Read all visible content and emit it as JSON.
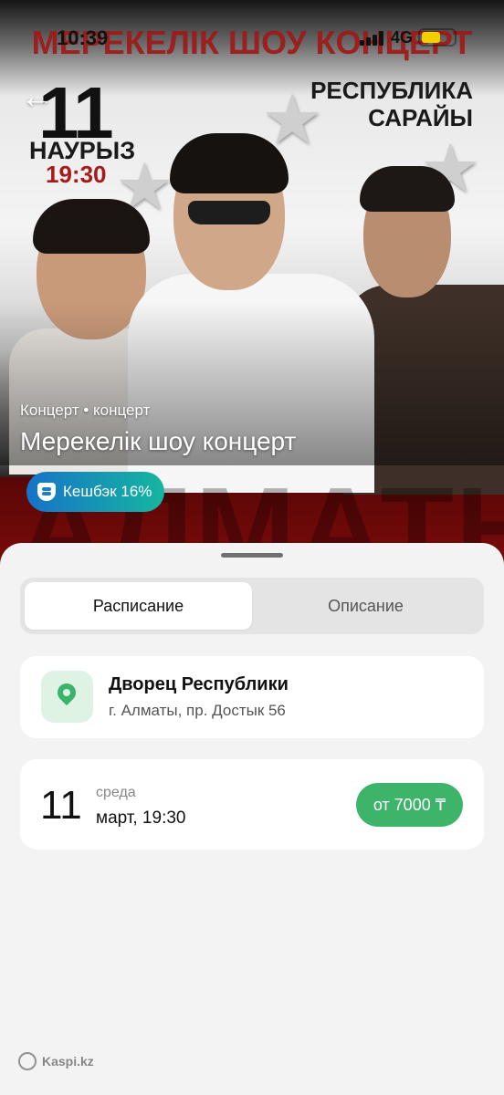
{
  "status_bar": {
    "time": "10:39",
    "network": "4G"
  },
  "poster": {
    "title": "МЕРЕКЕЛІК ШОУ КОНЦЕРТ",
    "day": "11",
    "month": "НАУРЫЗ",
    "time": "19:30",
    "venue_line1": "РЕСПУБЛИКА",
    "venue_line2": "САРАЙЫ",
    "city": "АЛМАТЫ"
  },
  "event": {
    "category": "Концерт • концерт",
    "title": "Мерекелік шоу концерт",
    "cashback": "Кешбэк 16%"
  },
  "tabs": [
    {
      "label": "Расписание",
      "active": true
    },
    {
      "label": "Описание",
      "active": false
    }
  ],
  "venue": {
    "name": "Дворец Республики",
    "address": "г. Алматы, пр. Достык 56"
  },
  "session": {
    "day": "11",
    "weekday": "среда",
    "date_time": "март, 19:30",
    "price": "от 7000 ₸"
  },
  "watermark": "Kaspi.kz",
  "colors": {
    "accent_green": "#3db469",
    "cashback_start": "#1673c8",
    "cashback_end": "#16b6a0"
  }
}
